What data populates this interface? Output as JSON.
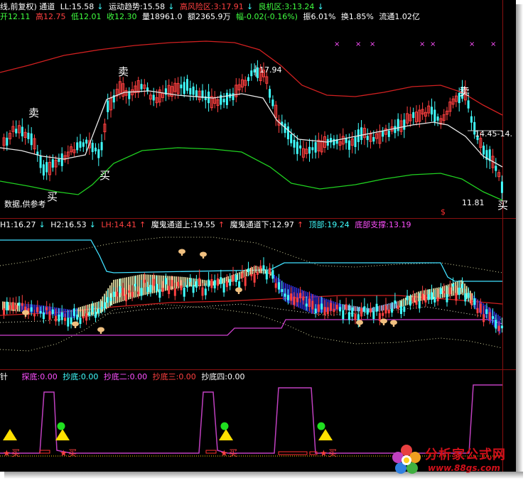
{
  "header1": {
    "title": "线,前复权) 通道",
    "ll": "LL:15.58",
    "trend": "运动趋势:15.58",
    "risk": "高风险区:3:17.91",
    "chance": "良机区:3:13.24"
  },
  "header2": {
    "open": "开12.11",
    "high": "高12.75",
    "low": "低12.01",
    "close": "收12.30",
    "volume": "量18961.0",
    "amount": "额2365.9万",
    "change": "幅-0.02(-0.16%)",
    "amplitude": "振6.01%",
    "turnover": "换1.85%",
    "float": "流通1.02亿"
  },
  "main_chart": {
    "labels": {
      "sell_1": "卖",
      "sell_2": "卖",
      "sell_3": "卖",
      "buy_1": "买",
      "buy_2": "买",
      "buy_3": "买",
      "peak_value": "17.94",
      "low_value": "11.81",
      "price_tag": "14.45-14.",
      "disclaimer": "数据,供参考",
      "red_marker": "$"
    },
    "x_marks": [
      "×",
      "×",
      "×",
      "×",
      "×",
      "×",
      "×"
    ]
  },
  "indicator2": {
    "h1": "H1:16.27",
    "h2": "H2:16.53",
    "lh": "LH:14.41",
    "up": "魔鬼通道上:19.55",
    "down": "魔鬼通道下:12.97",
    "top": "顶部:19.24",
    "bottom": "底部支撑:13.19"
  },
  "indicator3": {
    "name": "针",
    "probe": "探底:0.00",
    "copy1": "抄底:0.00",
    "copy2": "抄底二:0.00",
    "copy3": "抄底三:0.00",
    "copy4": "抄底四:0.00",
    "buy_label": "买"
  },
  "logo": {
    "name": "分析家公式网",
    "url": "www.88gs.com"
  },
  "colors": {
    "white": "#ffffff",
    "yellow": "#ffff50",
    "red": "#ff4040",
    "green": "#40ff40",
    "cyan": "#40ffff",
    "magenta": "#ff50ff",
    "blue": "#3030e0"
  }
}
